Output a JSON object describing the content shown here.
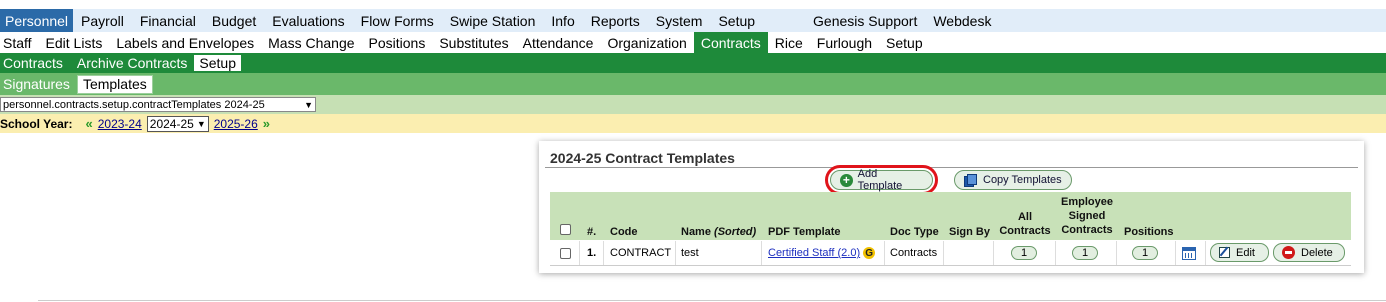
{
  "menu_primary": [
    "Personnel",
    "Payroll",
    "Financial",
    "Budget",
    "Evaluations",
    "Flow Forms",
    "Swipe Station",
    "Info",
    "Reports",
    "System",
    "Setup",
    "Genesis Support",
    "Webdesk"
  ],
  "menu_secondary": [
    "Staff",
    "Edit Lists",
    "Labels and Envelopes",
    "Mass Change",
    "Positions",
    "Substitutes",
    "Attendance",
    "Organization",
    "Contracts",
    "Rice",
    "Furlough",
    "Setup"
  ],
  "menu_tertiary": [
    "Contracts",
    "Archive Contracts",
    "Setup"
  ],
  "menu_quaternary": [
    "Signatures",
    "Templates"
  ],
  "path_select": {
    "value": "personnel.contracts.setup.contractTemplates 2024-25"
  },
  "school_year": {
    "label": "School Year:",
    "prev_arrow": "«",
    "prev_year": "2023-24",
    "selected": "2024-25",
    "next_year": "2025-26",
    "next_arrow": "»"
  },
  "panel": {
    "title": "2024-25 Contract Templates",
    "add_button": "Add Template",
    "copy_button": "Copy Templates"
  },
  "table": {
    "headers": {
      "num": "#.",
      "code": "Code",
      "name": "Name",
      "name_sort": "(Sorted)",
      "pdf": "PDF Template",
      "doctype": "Doc Type",
      "signby": "Sign By",
      "all1": "All",
      "all2": "Contracts",
      "emp1": "Employee",
      "emp2": "Signed",
      "emp3": "Contracts",
      "positions": "Positions"
    },
    "rows": [
      {
        "num": "1.",
        "code": "CONTRACT",
        "name": "test",
        "pdf_template": "Certified Staff (2.0)",
        "doc_type": "Contracts",
        "sign_by": "",
        "all_contracts": "1",
        "employee_signed": "1",
        "positions": "1",
        "edit_label": "Edit",
        "delete_label": "Delete"
      }
    ]
  },
  "colors": {
    "primary_active": "#2b6aa8",
    "green_bar": "#1e8a3a",
    "light_green_bar": "#6ab86a",
    "highlight_outline": "#e0141b"
  }
}
